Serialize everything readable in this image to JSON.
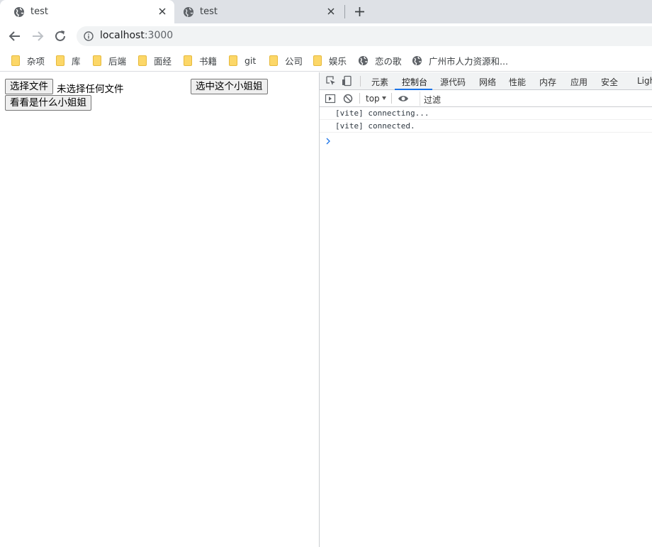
{
  "browser": {
    "tabs": [
      {
        "title": "test",
        "active": true
      },
      {
        "title": "test",
        "active": false
      }
    ],
    "address": {
      "host": "localhost",
      "port": ":3000"
    },
    "bookmarks": [
      {
        "label": "杂项",
        "icon": "folder-icon"
      },
      {
        "label": "库",
        "icon": "folder-icon"
      },
      {
        "label": "后端",
        "icon": "folder-icon"
      },
      {
        "label": "面经",
        "icon": "folder-icon"
      },
      {
        "label": "书籍",
        "icon": "folder-icon"
      },
      {
        "label": "git",
        "icon": "folder-icon"
      },
      {
        "label": "公司",
        "icon": "folder-icon"
      },
      {
        "label": "娱乐",
        "icon": "folder-icon"
      },
      {
        "label": "恋の歌",
        "icon": "globe-icon"
      },
      {
        "label": "广州市人力资源和...",
        "icon": "globe-icon"
      }
    ]
  },
  "page": {
    "choose_file_button": "选择文件",
    "file_status": "未选择任何文件",
    "select_button": "选中这个小姐姐",
    "view_button": "看看是什么小姐姐"
  },
  "devtools": {
    "tabs": [
      "元素",
      "控制台",
      "源代码",
      "网络",
      "性能",
      "内存",
      "应用",
      "安全",
      "Ligh"
    ],
    "active_tab": "控制台",
    "context": "top",
    "filter_placeholder": "过滤",
    "console_lines": [
      "[vite] connecting...",
      "[vite] connected."
    ]
  },
  "colors": {
    "tabstrip_bg": "#dee1e6",
    "omnibox_bg": "#f1f3f4",
    "folder_yellow": "#fcd768",
    "accent_blue": "#1a73e8"
  }
}
